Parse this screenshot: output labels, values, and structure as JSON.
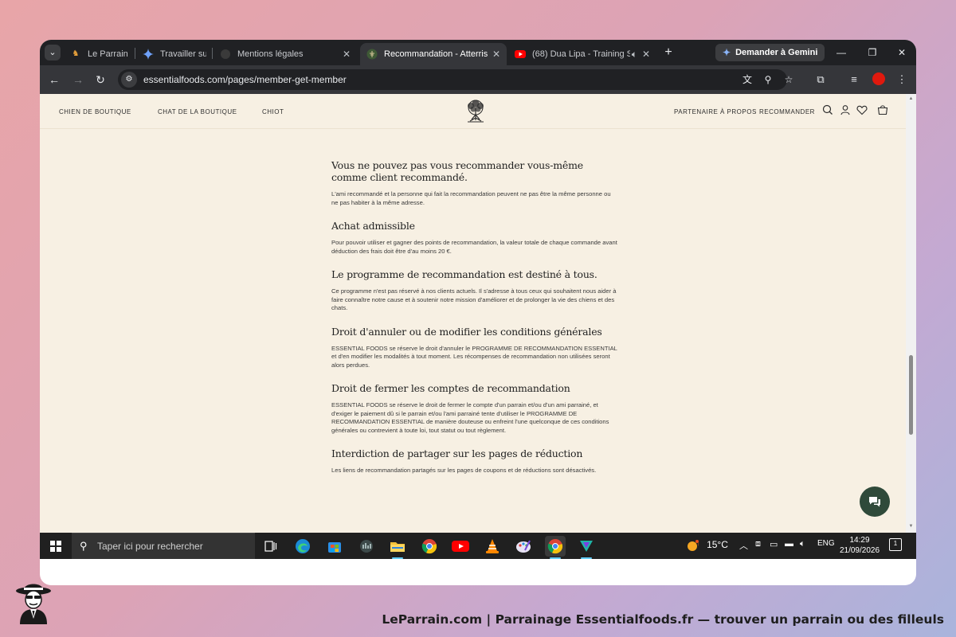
{
  "browser": {
    "tabs": [
      {
        "title": "Le Parrain - L",
        "active": false,
        "favicon": "parrain-favicon"
      },
      {
        "title": "Travailler sur",
        "active": false,
        "favicon": "gemini-favicon"
      },
      {
        "title": "Mentions légales",
        "active": false,
        "favicon": "essentialfoods-favicon"
      },
      {
        "title": "Recommandation - Atterrissag",
        "active": true,
        "favicon": "essentialfoods-favicon"
      },
      {
        "title": "(68) Dua Lipa - Training Se",
        "active": false,
        "favicon": "youtube-favicon"
      }
    ],
    "gemini_button": "Demander à Gemini",
    "url": "essentialfoods.com/pages/member-get-member",
    "profile_color": "#e0190e"
  },
  "site": {
    "nav_left": [
      "CHIEN DE BOUTIQUE",
      "CHAT DE LA BOUTIQUE",
      "CHIOT"
    ],
    "nav_right": [
      "PARTENAIRE",
      "À PROPOS",
      "RECOMMANDER"
    ],
    "accent": "#2f4a3a",
    "background": "#f7f0e3"
  },
  "article": {
    "sections": [
      {
        "heading": "Vous ne pouvez pas vous recommander vous-même comme client recommandé.",
        "body": "L'ami recommandé et la personne qui fait la recommandation peuvent ne pas être la même personne ou ne pas habiter à la même adresse."
      },
      {
        "heading": "Achat admissible",
        "body": "Pour pouvoir utiliser et gagner des points de recommandation, la valeur totale de chaque commande avant déduction des frais doit être d'au moins 20 €."
      },
      {
        "heading": "Le programme de recommandation est destiné à tous.",
        "body": "Ce programme n'est pas réservé à nos clients actuels. Il s'adresse à tous ceux qui souhaitent nous aider à faire connaître notre cause et à soutenir notre mission d'améliorer et de prolonger la vie des chiens et des chats."
      },
      {
        "heading": "Droit d'annuler ou de modifier les conditions générales",
        "body": "ESSENTIAL FOODS se réserve le droit d'annuler le PROGRAMME DE RECOMMANDATION ESSENTIAL et d'en modifier les modalités à tout moment. Les récompenses de recommandation non utilisées seront alors perdues."
      },
      {
        "heading": "Droit de fermer les comptes de recommandation",
        "body": "ESSENTIAL FOODS se réserve le droit de fermer le compte d'un parrain et/ou d'un ami parrainé, et d'exiger le paiement dû si le parrain et/ou l'ami parrainé tente d'utiliser le PROGRAMME DE RECOMMANDATION ESSENTIAL de manière douteuse ou enfreint l'une quelconque de ces conditions générales ou contrevient à toute loi, tout statut ou tout règlement."
      },
      {
        "heading": "Interdiction de partager sur les pages de réduction",
        "body": "Les liens de recommandation partagés sur les pages de coupons et de réductions sont désactivés."
      }
    ]
  },
  "taskbar": {
    "search_placeholder": "Taper ici pour rechercher",
    "apps": [
      "task-view",
      "edge",
      "microsoft-store",
      "app-dark",
      "file-explorer",
      "chrome",
      "youtube",
      "vlc",
      "paint",
      "chrome-active",
      "app-teal"
    ],
    "weather": "15°C",
    "language": "ENG",
    "time": "14:29",
    "date": "21/09/2026",
    "notifications": "1"
  },
  "footer": {
    "caption": "LeParrain.com | Parrainage Essentialfoods.fr — trouver un parrain ou des filleuls"
  }
}
